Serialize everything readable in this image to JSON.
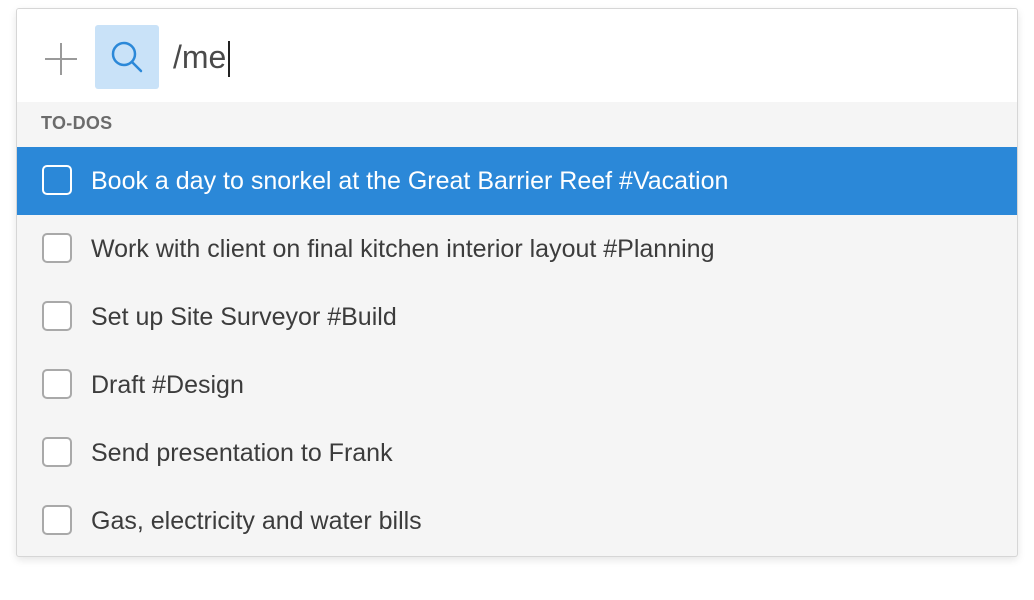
{
  "search": {
    "query": "/me",
    "add_icon": "plus-icon",
    "search_icon": "magnifier-icon"
  },
  "section": {
    "title": "TO-DOS"
  },
  "todos": [
    {
      "label": "Book a day to snorkel at the Great Barrier Reef #Vacation",
      "selected": true,
      "checked": false
    },
    {
      "label": "Work with client on final kitchen interior layout #Planning",
      "selected": false,
      "checked": false
    },
    {
      "label": "Set up Site Surveyor #Build",
      "selected": false,
      "checked": false
    },
    {
      "label": "Draft #Design",
      "selected": false,
      "checked": false
    },
    {
      "label": "Send presentation to Frank",
      "selected": false,
      "checked": false
    },
    {
      "label": "Gas, electricity and water bills",
      "selected": false,
      "checked": false
    }
  ],
  "colors": {
    "selection": "#2b88d8",
    "search_button_bg": "#c9e2f8",
    "icon_blue": "#2b88d8"
  }
}
